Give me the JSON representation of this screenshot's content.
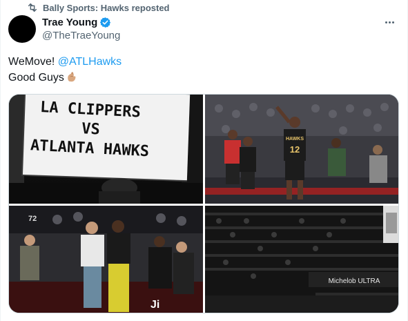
{
  "repost": {
    "text": "Bally Sports: Hawks reposted",
    "icon": "repost-icon"
  },
  "author": {
    "name": "Trae Young",
    "handle": "@TheTraeYoung",
    "verified": true,
    "verified_color": "#1d9bf0"
  },
  "tweet": {
    "line1_prefix": "WeMove! ",
    "mention": "@ATLHawks",
    "line2": "Good Guys",
    "emoji": "pinching-hand-emoji"
  },
  "media": {
    "photo1": {
      "sign_line1": "LA CLIPPERS",
      "sign_line2": "VS",
      "sign_line3": "ATLANTA HAWKS"
    },
    "photo2": {
      "jersey_number": "12",
      "jersey_text": "HAWKS"
    },
    "photo3": {
      "court_text": "Ji",
      "jersey_number": "72"
    },
    "photo4": {
      "banner_text": "Michelob ULTRA"
    }
  },
  "colors": {
    "mention": "#1d9bf0",
    "secondary_text": "#536471",
    "border": "#cfd9de"
  }
}
